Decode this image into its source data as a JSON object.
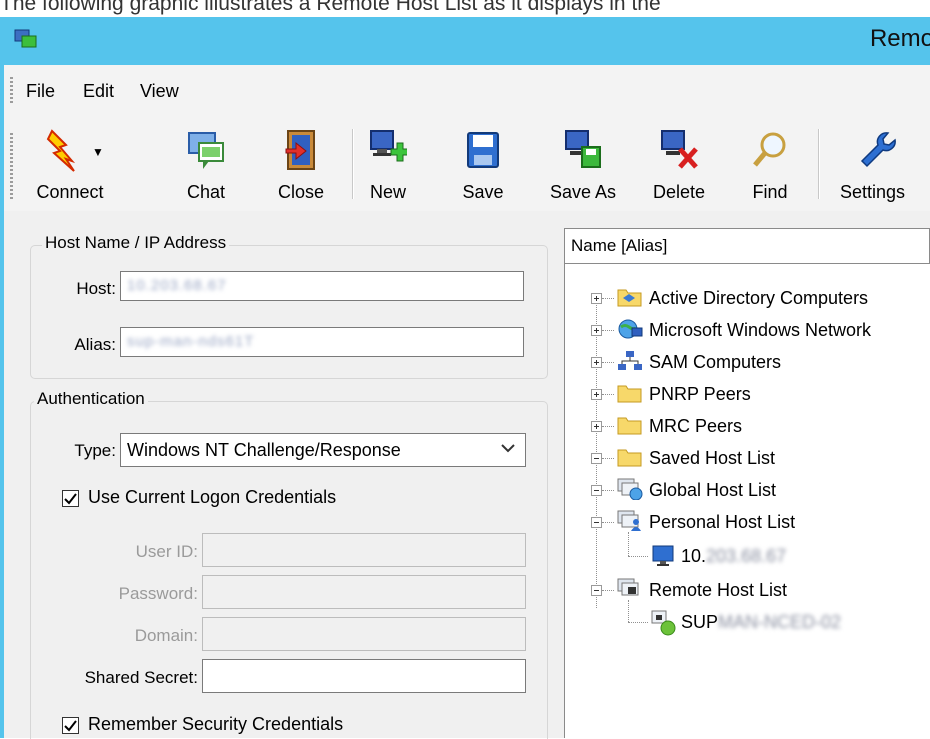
{
  "caption": "The following graphic illustrates a Remote Host List as it displays in the",
  "window": {
    "title": "Remo"
  },
  "menu": {
    "items": [
      "File",
      "Edit",
      "View"
    ]
  },
  "toolbar": {
    "connect": "Connect",
    "chat": "Chat",
    "close": "Close",
    "new": "New",
    "save": "Save",
    "save_as": "Save As",
    "delete": "Delete",
    "find": "Find",
    "settings": "Settings"
  },
  "host_group": {
    "title": "Host Name / IP Address",
    "host_label": "Host:",
    "host_value": "10.203.68.67",
    "alias_label": "Alias:",
    "alias_value": "sup-man-nds61T"
  },
  "auth_group": {
    "title": "Authentication",
    "type_label": "Type:",
    "type_value": "Windows NT Challenge/Response",
    "use_current_label": "Use Current Logon Credentials",
    "use_current_checked": true,
    "user_id_label": "User ID:",
    "password_label": "Password:",
    "domain_label": "Domain:",
    "shared_secret_label": "Shared Secret:",
    "remember_label": "Remember Security Credentials",
    "remember_checked": true
  },
  "tree": {
    "column_header": "Name [Alias]",
    "nodes": [
      "Active Directory Computers",
      "Microsoft Windows Network",
      "SAM Computers",
      "PNRP Peers",
      "MRC Peers",
      "Saved Host List",
      "Global Host List",
      "Personal Host List",
      "Remote Host List"
    ],
    "personal_child_prefix": "10.",
    "personal_child_rest": "203.68.67",
    "remote_child_prefix": "SUP",
    "remote_child_rest": "MAN-NCED-02"
  },
  "colors": {
    "titlebar": "#55c4ec",
    "window_bg": "#f0f0f0"
  }
}
